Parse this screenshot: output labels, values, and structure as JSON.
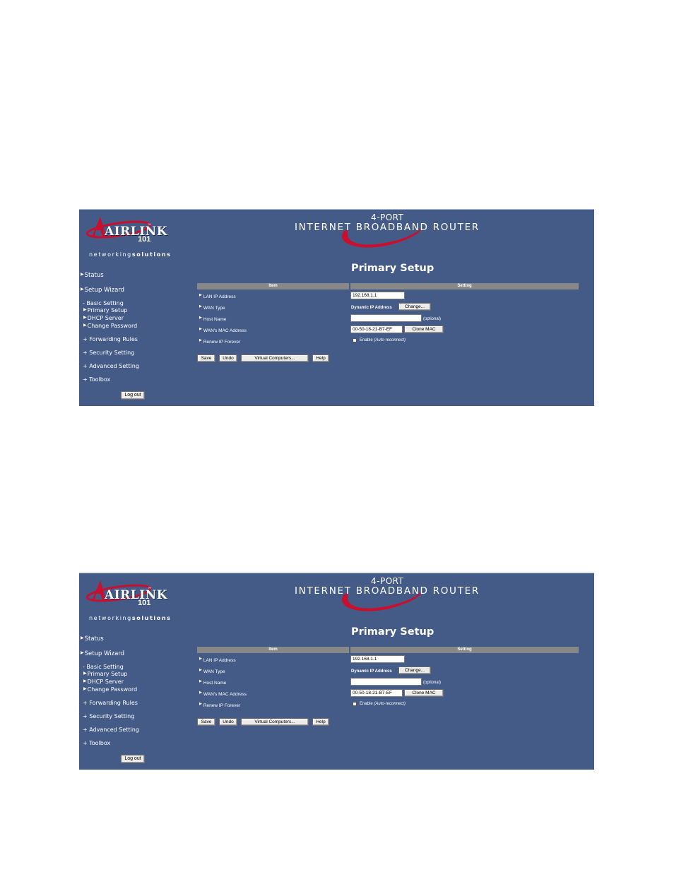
{
  "logo": {
    "text": "AIRLINK",
    "tm": "™",
    "num": "101",
    "tagline_a": "networking",
    "tagline_b": "solutions"
  },
  "banner": {
    "port": "4-PORT",
    "title": "INTERNET BROADBAND ROUTER"
  },
  "nav": {
    "status": "Status",
    "setup_wizard": "Setup Wizard",
    "basic_setting": "- Basic Setting",
    "primary_setup": "Primary Setup",
    "dhcp_server": "DHCP Server",
    "change_password": "Change Password",
    "forwarding_rules": "+ Forwarding Rules",
    "security_setting": "+ Security Setting",
    "advanced_setting": "+ Advanced Setting",
    "toolbox": "+ Toolbox",
    "logout": "Log out"
  },
  "page": {
    "title": "Primary Setup",
    "col_item": "Item",
    "col_setting": "Setting",
    "rows": {
      "lan_ip_label": "LAN IP Address",
      "lan_ip_value": "192.168.1.1",
      "wan_type_label": "WAN Type",
      "wan_type_value": "Dynamic IP Address",
      "wan_type_button": "Change...",
      "host_name_label": "Host Name",
      "host_name_value": "",
      "host_name_note": "(optional)",
      "wan_mac_label": "WAN's MAC Address",
      "wan_mac_value": "00-50-18-21-B7-EF",
      "clone_mac_button": "Clone MAC",
      "renew_ip_label": "Renew IP Forever",
      "renew_enable": "Enable",
      "renew_note": "(Auto-reconnect)"
    },
    "buttons": {
      "save": "Save",
      "undo": "Undo",
      "virtual_computers": "Virtual Computers...",
      "help": "Help"
    }
  },
  "colors": {
    "panel": "#445b88",
    "header_bar": "#888888",
    "swoosh": "#c8102e"
  }
}
